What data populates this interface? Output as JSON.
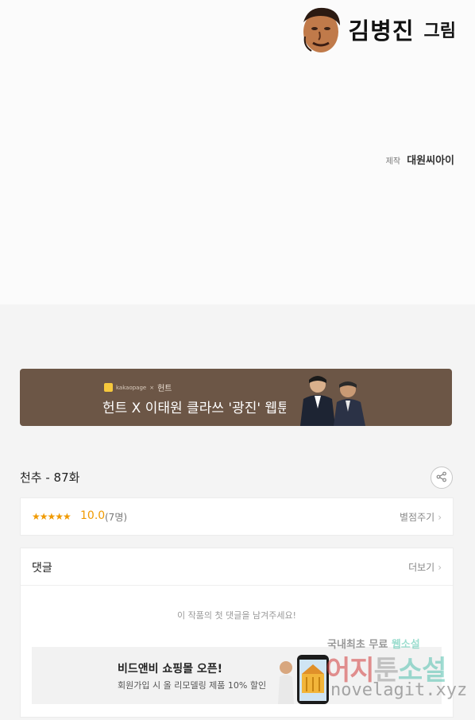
{
  "credits": {
    "artist_name": "김병진",
    "artist_role": "그림",
    "producer_label": "제작",
    "producer_name": "대원씨아이"
  },
  "banner": {
    "brand_small": "kakaopage",
    "brand_x": "×",
    "brand_name": "헌트",
    "headline": "헌트 X 이태원 클라쓰 '광진' 웹툰"
  },
  "episode": {
    "title": "천추 - 87화"
  },
  "rating": {
    "stars": "★★★★★",
    "score": "10.0",
    "count": "(7명)",
    "rate_link": "별점주기",
    "chevron": "›"
  },
  "comments": {
    "title": "댓글",
    "more_link": "더보기",
    "chevron": "›",
    "empty_text": "이 작품의 첫 댓글을 남겨주세요!"
  },
  "ad": {
    "title": "비드앤비 쇼핑몰 오픈!",
    "subtitle": "회원가입 시 올 리모델링 제품 10% 할인"
  },
  "watermark": {
    "line1_a": "국내최초 무료",
    "line1_b": "웹소설",
    "line2_a": "어지",
    "line2_b": "툰",
    "line2_c": "소설",
    "line3": "novelagit.xyz"
  },
  "colors": {
    "banner_bg": "#6c5646",
    "rating_accent": "#f09a00",
    "page_bg": "#f4f4f4"
  },
  "icons": [
    "artist-portrait-icon",
    "share-icon",
    "chevron-right-icon"
  ]
}
